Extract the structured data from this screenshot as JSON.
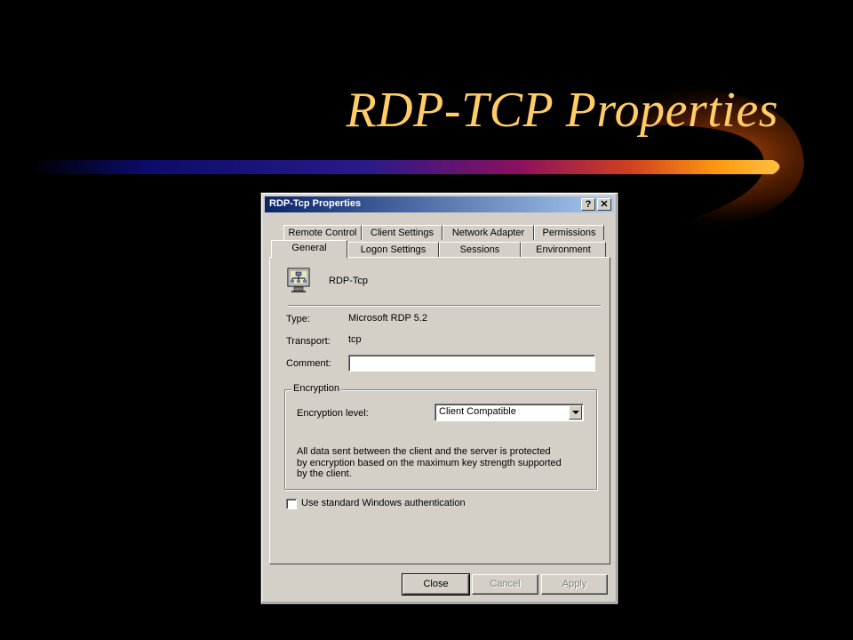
{
  "slide": {
    "title": "RDP-TCP Properties"
  },
  "dialog": {
    "title": "RDP-Tcp Properties",
    "help_button": "?",
    "close_button": "✕",
    "tabs_back": [
      "Remote Control",
      "Client Settings",
      "Network Adapter",
      "Permissions"
    ],
    "tabs_front": [
      "General",
      "Logon Settings",
      "Sessions",
      "Environment"
    ],
    "active_tab": "General",
    "connection_name": "RDP-Tcp",
    "type_label": "Type:",
    "type_value": "Microsoft RDP 5.2",
    "transport_label": "Transport:",
    "transport_value": "tcp",
    "comment_label": "Comment:",
    "comment_value": "",
    "encryption_group": "Encryption",
    "encryption_level_label": "Encryption level:",
    "encryption_level_value": "Client Compatible",
    "encryption_description": "All data sent between the client and the server is protected by encryption based on the maximum key strength supported by the client.",
    "windows_auth_label": "Use standard Windows authentication",
    "windows_auth_checked": false,
    "buttons": {
      "close": "Close",
      "cancel": "Cancel",
      "apply": "Apply"
    }
  }
}
